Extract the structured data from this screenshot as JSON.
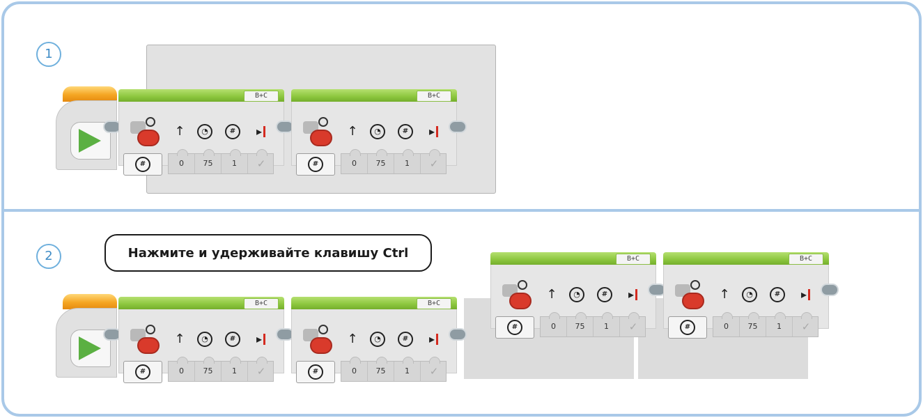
{
  "steps": [
    {
      "number": "1"
    },
    {
      "number": "2"
    }
  ],
  "callout": {
    "text": "Нажмите и удерживайте клавишу Ctrl"
  },
  "move_block": {
    "port_label": "B+C",
    "params": {
      "steering": "0",
      "power": "75",
      "rotations": "1",
      "brake": "✓"
    }
  },
  "icons": {
    "start": "play-icon",
    "motor": "motor-icon",
    "steering": "up-arrow-icon",
    "power": "speedometer-icon",
    "rotations": "rotations-icon",
    "brake": "brake-icon",
    "mode": "mode-rotations-icon"
  },
  "colors": {
    "panel_border": "#a9c9e8",
    "step_circle": "#6fb0dd",
    "start_orange": "#f5a623",
    "start_play": "#5bb042",
    "move_green": "#8cc63e",
    "motor_red": "#d93a2b"
  }
}
